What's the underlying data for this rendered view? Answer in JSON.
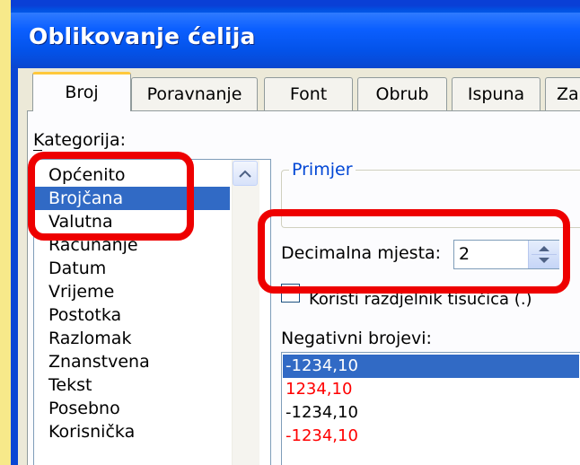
{
  "window": {
    "title": "Oblikovanje ćelija"
  },
  "tabs": [
    {
      "label": "Broj",
      "active": true
    },
    {
      "label": "Poravnanje",
      "active": false
    },
    {
      "label": "Font",
      "active": false
    },
    {
      "label": "Obrub",
      "active": false
    },
    {
      "label": "Ispuna",
      "active": false
    },
    {
      "label": "Za",
      "active": false
    }
  ],
  "category": {
    "label": "Kategorija:",
    "items": [
      "Općenito",
      "Brojčana",
      "Valutna",
      "Računanje",
      "Datum",
      "Vrijeme",
      "Postotka",
      "Razlomak",
      "Znanstvena",
      "Tekst",
      "Posebno",
      "Korisnička"
    ],
    "selected": "Brojčana"
  },
  "sample": {
    "label": "Primjer"
  },
  "decimal": {
    "label": "Decimalna mjesta:",
    "value": "2"
  },
  "thousands_separator": {
    "label": "Koristi razdjelnik tisućica (.)",
    "checked": false
  },
  "negative": {
    "label": "Negativni brojevi:",
    "items": [
      {
        "text": "-1234,10",
        "color": "#ffffff",
        "selected": true
      },
      {
        "text": "1234,10",
        "color": "#ff0000",
        "selected": false
      },
      {
        "text": "-1234,10",
        "color": "#000000",
        "selected": false
      },
      {
        "text": "-1234,10",
        "color": "#ff0000",
        "selected": false
      }
    ]
  },
  "colors": {
    "accent": "#316ac5",
    "highlight": "#ee0000",
    "titlebar": "#0352e8"
  }
}
